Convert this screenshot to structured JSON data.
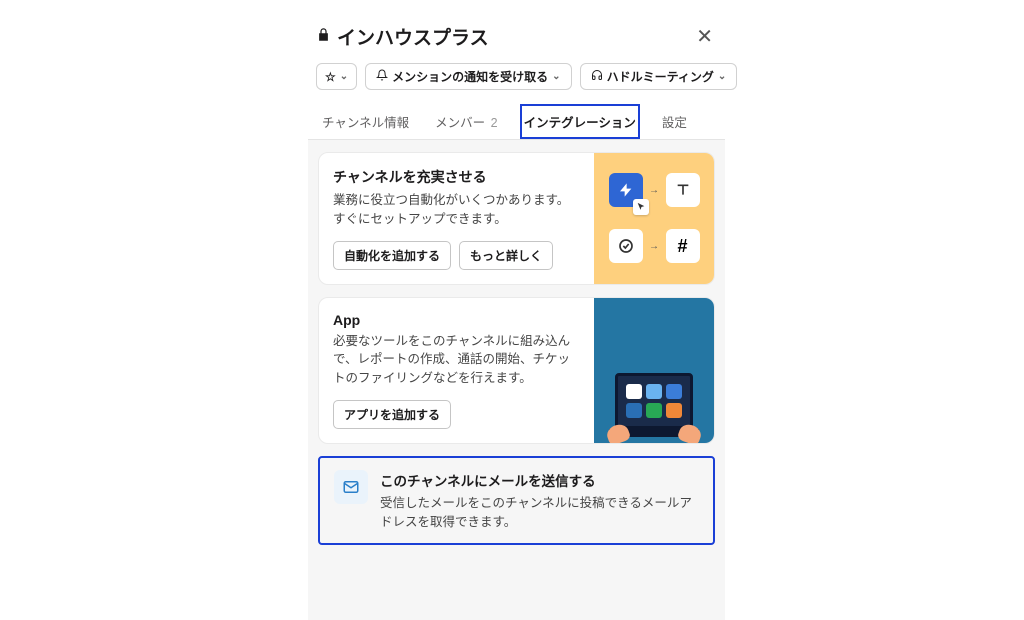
{
  "header": {
    "title": "インハウスプラス"
  },
  "toolbar": {
    "mention_label": "メンションの通知を受け取る",
    "huddle_label": "ハドルミーティング"
  },
  "tabs": {
    "channel_info": "チャンネル情報",
    "members": "メンバー",
    "member_count": "2",
    "integration": "インテグレーション",
    "settings": "設定"
  },
  "cards": {
    "automation": {
      "title": "チャンネルを充実させる",
      "desc": "業務に役立つ自動化がいくつかあります。すぐにセットアップできます。",
      "add_btn": "自動化を追加する",
      "more_btn": "もっと詳しく"
    },
    "app": {
      "title": "App",
      "desc": "必要なツールをこのチャンネルに組み込んで、レポートの作成、通話の開始、チケットのファイリングなどを行えます。",
      "add_btn": "アプリを追加する"
    },
    "email": {
      "title": "このチャンネルにメールを送信する",
      "desc": "受信したメールをこのチャンネルに投稿できるメールアドレスを取得できます。"
    }
  }
}
